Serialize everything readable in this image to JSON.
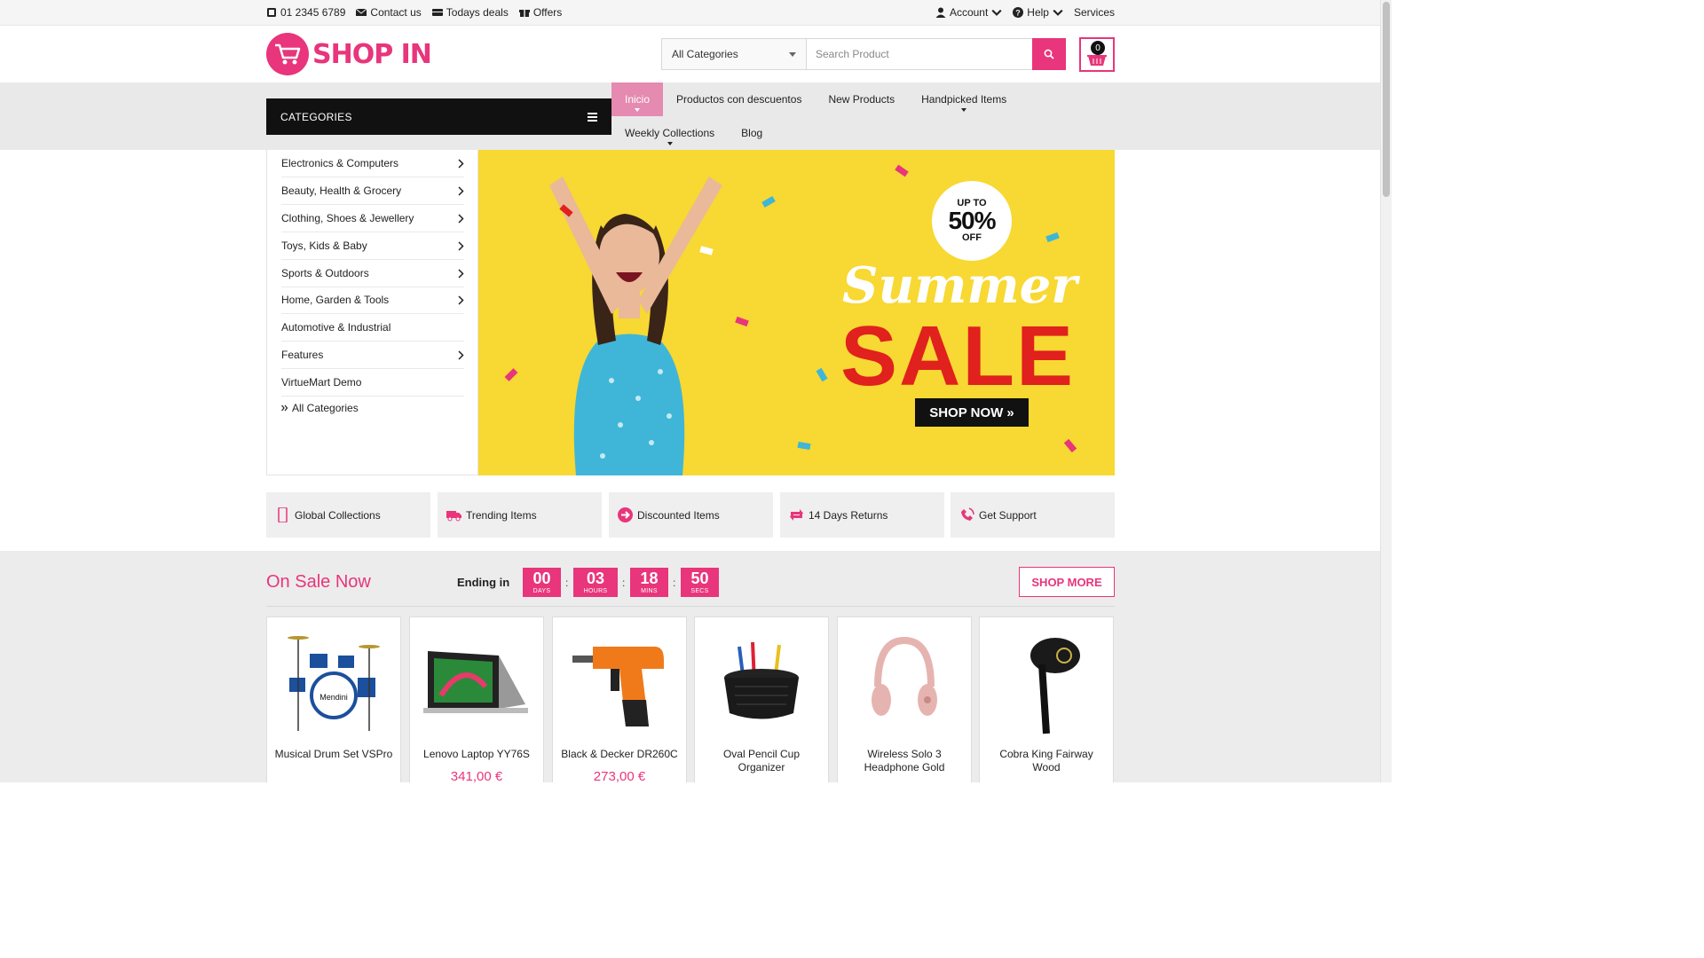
{
  "topbar": {
    "phone": "01 2345 6789",
    "contact": "Contact us",
    "deals": "Todays deals",
    "offers": "Offers",
    "account": "Account",
    "help": "Help",
    "services": "Services"
  },
  "header": {
    "logo_text": "SHOP IN",
    "category_select": "All Categories",
    "search_placeholder": "Search Product",
    "cart_count": "0"
  },
  "categories_label": "CATEGORIES",
  "menu": {
    "row1": [
      "Inicio",
      "Productos con descuentos",
      "New Products",
      "Handpicked Items"
    ],
    "row2": [
      "Weekly Collections",
      "Blog"
    ]
  },
  "sidebar": {
    "items": [
      "Electronics & Computers",
      "Beauty, Health & Grocery",
      "Clothing, Shoes & Jewellery",
      "Toys, Kids & Baby",
      "Sports & Outdoors",
      "Home, Garden & Tools",
      "Automotive & Industrial",
      "Features",
      "VirtueMart Demo"
    ],
    "all": "All Categories"
  },
  "banner": {
    "up_to": "UP TO",
    "percent": "50%",
    "off": "OFF",
    "summer": "Summer",
    "sale": "SALE",
    "shop_now": "SHOP NOW »"
  },
  "features": [
    "Global Collections",
    "Trending Items",
    "Discounted Items",
    "14 Days Returns",
    "Get Support"
  ],
  "on_sale": {
    "title": "On Sale Now",
    "ending": "Ending in",
    "countdown": [
      {
        "value": "00",
        "label": "DAYS"
      },
      {
        "value": "03",
        "label": "HOURS"
      },
      {
        "value": "18",
        "label": "MINS"
      },
      {
        "value": "50",
        "label": "SECS"
      }
    ],
    "shop_more": "SHOP MORE",
    "products": [
      {
        "name": "Musical Drum Set VSPro",
        "price": ""
      },
      {
        "name": "Lenovo Laptop YY76S",
        "price": "341,00 €"
      },
      {
        "name": "Black & Decker DR260C",
        "price": "273,00 €"
      },
      {
        "name": "Oval Pencil Cup Organizer",
        "price": ""
      },
      {
        "name": "Wireless Solo 3 Headphone Gold",
        "price": ""
      },
      {
        "name": "Cobra King Fairway Wood",
        "price": ""
      }
    ]
  },
  "colors": {
    "accent": "#e8357b",
    "banner_bg": "#f8d832",
    "sale_red": "#e0211d"
  }
}
